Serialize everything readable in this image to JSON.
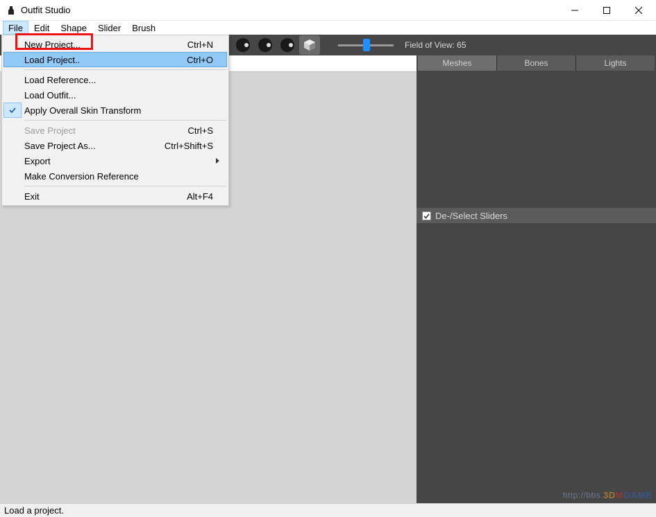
{
  "window": {
    "title": "Outfit Studio"
  },
  "menubar": {
    "items": [
      "File",
      "Edit",
      "Shape",
      "Slider",
      "Brush"
    ],
    "open_index": 0
  },
  "file_menu": {
    "new_project": {
      "label": "New Project...",
      "shortcut": "Ctrl+N"
    },
    "load_project": {
      "label": "Load Project..",
      "shortcut": "Ctrl+O"
    },
    "load_reference": {
      "label": "Load Reference..."
    },
    "load_outfit": {
      "label": "Load Outfit..."
    },
    "apply_skin": {
      "label": "Apply Overall Skin Transform",
      "checked": true
    },
    "save_project": {
      "label": "Save Project",
      "shortcut": "Ctrl+S",
      "disabled": true
    },
    "save_project_as": {
      "label": "Save Project As...",
      "shortcut": "Ctrl+Shift+S"
    },
    "export": {
      "label": "Export",
      "submenu": true
    },
    "make_conv_ref": {
      "label": "Make Conversion Reference"
    },
    "exit": {
      "label": "Exit",
      "shortcut": "Alt+F4"
    }
  },
  "toolbar": {
    "fov_label": "Field of View: 65",
    "fov_value": 65
  },
  "right_panel": {
    "tabs": [
      "Meshes",
      "Bones",
      "Lights"
    ],
    "active_tab": 0,
    "slider_header": "De-/Select Sliders",
    "slider_checked": true
  },
  "statusbar": {
    "text": "Load a project."
  },
  "watermark": {
    "url": "http://bbs.",
    "brand1": "3D",
    "brand2": "M",
    "brand3": "GAME"
  }
}
